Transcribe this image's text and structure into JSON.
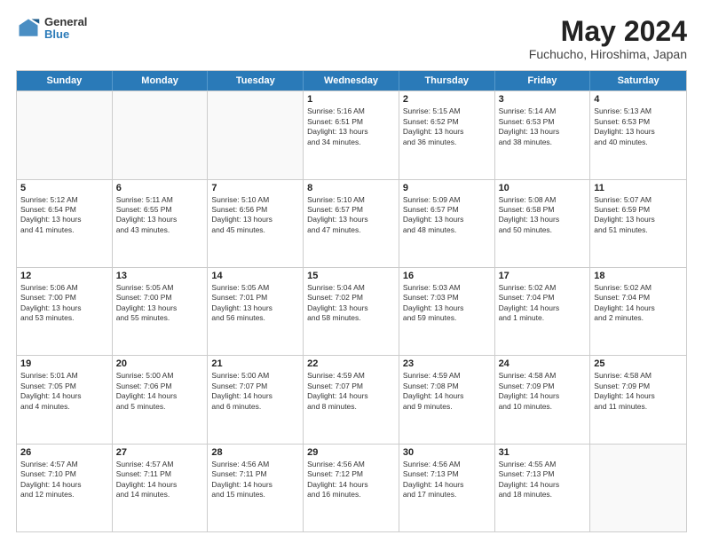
{
  "header": {
    "logo_general": "General",
    "logo_blue": "Blue",
    "title": "May 2024",
    "location": "Fuchucho, Hiroshima, Japan"
  },
  "calendar": {
    "days_of_week": [
      "Sunday",
      "Monday",
      "Tuesday",
      "Wednesday",
      "Thursday",
      "Friday",
      "Saturday"
    ],
    "rows": [
      [
        {
          "day": "",
          "empty": true
        },
        {
          "day": "",
          "empty": true
        },
        {
          "day": "",
          "empty": true
        },
        {
          "day": "1",
          "lines": [
            "Sunrise: 5:16 AM",
            "Sunset: 6:51 PM",
            "Daylight: 13 hours",
            "and 34 minutes."
          ]
        },
        {
          "day": "2",
          "lines": [
            "Sunrise: 5:15 AM",
            "Sunset: 6:52 PM",
            "Daylight: 13 hours",
            "and 36 minutes."
          ]
        },
        {
          "day": "3",
          "lines": [
            "Sunrise: 5:14 AM",
            "Sunset: 6:53 PM",
            "Daylight: 13 hours",
            "and 38 minutes."
          ]
        },
        {
          "day": "4",
          "lines": [
            "Sunrise: 5:13 AM",
            "Sunset: 6:53 PM",
            "Daylight: 13 hours",
            "and 40 minutes."
          ]
        }
      ],
      [
        {
          "day": "5",
          "lines": [
            "Sunrise: 5:12 AM",
            "Sunset: 6:54 PM",
            "Daylight: 13 hours",
            "and 41 minutes."
          ]
        },
        {
          "day": "6",
          "lines": [
            "Sunrise: 5:11 AM",
            "Sunset: 6:55 PM",
            "Daylight: 13 hours",
            "and 43 minutes."
          ]
        },
        {
          "day": "7",
          "lines": [
            "Sunrise: 5:10 AM",
            "Sunset: 6:56 PM",
            "Daylight: 13 hours",
            "and 45 minutes."
          ]
        },
        {
          "day": "8",
          "lines": [
            "Sunrise: 5:10 AM",
            "Sunset: 6:57 PM",
            "Daylight: 13 hours",
            "and 47 minutes."
          ]
        },
        {
          "day": "9",
          "lines": [
            "Sunrise: 5:09 AM",
            "Sunset: 6:57 PM",
            "Daylight: 13 hours",
            "and 48 minutes."
          ]
        },
        {
          "day": "10",
          "lines": [
            "Sunrise: 5:08 AM",
            "Sunset: 6:58 PM",
            "Daylight: 13 hours",
            "and 50 minutes."
          ]
        },
        {
          "day": "11",
          "lines": [
            "Sunrise: 5:07 AM",
            "Sunset: 6:59 PM",
            "Daylight: 13 hours",
            "and 51 minutes."
          ]
        }
      ],
      [
        {
          "day": "12",
          "lines": [
            "Sunrise: 5:06 AM",
            "Sunset: 7:00 PM",
            "Daylight: 13 hours",
            "and 53 minutes."
          ]
        },
        {
          "day": "13",
          "lines": [
            "Sunrise: 5:05 AM",
            "Sunset: 7:00 PM",
            "Daylight: 13 hours",
            "and 55 minutes."
          ]
        },
        {
          "day": "14",
          "lines": [
            "Sunrise: 5:05 AM",
            "Sunset: 7:01 PM",
            "Daylight: 13 hours",
            "and 56 minutes."
          ]
        },
        {
          "day": "15",
          "lines": [
            "Sunrise: 5:04 AM",
            "Sunset: 7:02 PM",
            "Daylight: 13 hours",
            "and 58 minutes."
          ]
        },
        {
          "day": "16",
          "lines": [
            "Sunrise: 5:03 AM",
            "Sunset: 7:03 PM",
            "Daylight: 13 hours",
            "and 59 minutes."
          ]
        },
        {
          "day": "17",
          "lines": [
            "Sunrise: 5:02 AM",
            "Sunset: 7:04 PM",
            "Daylight: 14 hours",
            "and 1 minute."
          ]
        },
        {
          "day": "18",
          "lines": [
            "Sunrise: 5:02 AM",
            "Sunset: 7:04 PM",
            "Daylight: 14 hours",
            "and 2 minutes."
          ]
        }
      ],
      [
        {
          "day": "19",
          "lines": [
            "Sunrise: 5:01 AM",
            "Sunset: 7:05 PM",
            "Daylight: 14 hours",
            "and 4 minutes."
          ]
        },
        {
          "day": "20",
          "lines": [
            "Sunrise: 5:00 AM",
            "Sunset: 7:06 PM",
            "Daylight: 14 hours",
            "and 5 minutes."
          ]
        },
        {
          "day": "21",
          "lines": [
            "Sunrise: 5:00 AM",
            "Sunset: 7:07 PM",
            "Daylight: 14 hours",
            "and 6 minutes."
          ]
        },
        {
          "day": "22",
          "lines": [
            "Sunrise: 4:59 AM",
            "Sunset: 7:07 PM",
            "Daylight: 14 hours",
            "and 8 minutes."
          ]
        },
        {
          "day": "23",
          "lines": [
            "Sunrise: 4:59 AM",
            "Sunset: 7:08 PM",
            "Daylight: 14 hours",
            "and 9 minutes."
          ]
        },
        {
          "day": "24",
          "lines": [
            "Sunrise: 4:58 AM",
            "Sunset: 7:09 PM",
            "Daylight: 14 hours",
            "and 10 minutes."
          ]
        },
        {
          "day": "25",
          "lines": [
            "Sunrise: 4:58 AM",
            "Sunset: 7:09 PM",
            "Daylight: 14 hours",
            "and 11 minutes."
          ]
        }
      ],
      [
        {
          "day": "26",
          "lines": [
            "Sunrise: 4:57 AM",
            "Sunset: 7:10 PM",
            "Daylight: 14 hours",
            "and 12 minutes."
          ]
        },
        {
          "day": "27",
          "lines": [
            "Sunrise: 4:57 AM",
            "Sunset: 7:11 PM",
            "Daylight: 14 hours",
            "and 14 minutes."
          ]
        },
        {
          "day": "28",
          "lines": [
            "Sunrise: 4:56 AM",
            "Sunset: 7:11 PM",
            "Daylight: 14 hours",
            "and 15 minutes."
          ]
        },
        {
          "day": "29",
          "lines": [
            "Sunrise: 4:56 AM",
            "Sunset: 7:12 PM",
            "Daylight: 14 hours",
            "and 16 minutes."
          ]
        },
        {
          "day": "30",
          "lines": [
            "Sunrise: 4:56 AM",
            "Sunset: 7:13 PM",
            "Daylight: 14 hours",
            "and 17 minutes."
          ]
        },
        {
          "day": "31",
          "lines": [
            "Sunrise: 4:55 AM",
            "Sunset: 7:13 PM",
            "Daylight: 14 hours",
            "and 18 minutes."
          ]
        },
        {
          "day": "",
          "empty": true
        }
      ]
    ]
  }
}
